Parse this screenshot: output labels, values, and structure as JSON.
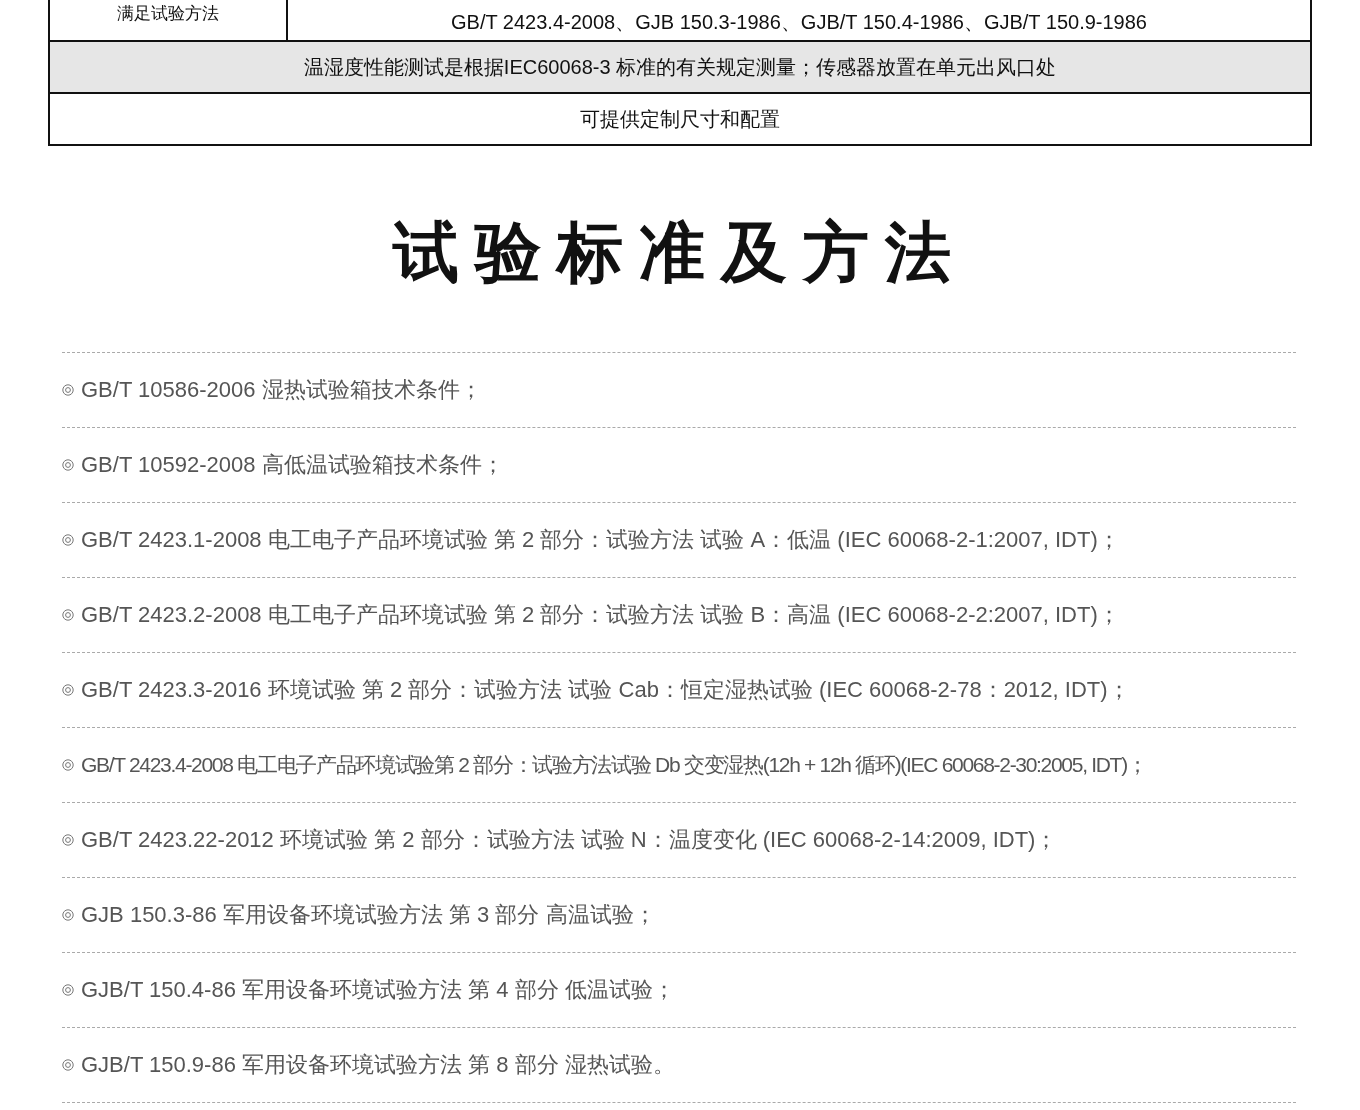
{
  "spec_table": {
    "rows": [
      {
        "kind": "split",
        "label": "满足试验方法",
        "value": "GB/T 2423.4-2008、GJB 150.3-1986、GJB/T 150.4-1986、GJB/T 150.9-1986"
      },
      {
        "kind": "note",
        "shaded": true,
        "value": "温湿度性能测试是根据IEC60068-3 标准的有关规定测量；传感器放置在单元出风口处"
      },
      {
        "kind": "note",
        "shaded": false,
        "value": "可提供定制尺寸和配置"
      }
    ]
  },
  "section_title": "试验标准及方法",
  "standards": [
    {
      "kind": "normal",
      "text": "GB/T 10586-2006 湿热试验箱技术条件；"
    },
    {
      "kind": "normal",
      "text": "GB/T 10592-2008 高低温试验箱技术条件；"
    },
    {
      "kind": "normal",
      "text": "GB/T 2423.1-2008 电工电子产品环境试验 第 2 部分：试验方法 试验 A：低温 (IEC 60068-2-1:2007, IDT)；"
    },
    {
      "kind": "normal",
      "text": "GB/T 2423.2-2008 电工电子产品环境试验 第 2 部分：试验方法 试验 B：高温 (IEC 60068-2-2:2007, IDT)；"
    },
    {
      "kind": "normal",
      "text": "GB/T 2423.3-2016 环境试验 第 2 部分：试验方法 试验 Cab：恒定湿热试验 (IEC 60068-2-78：2012, IDT)；"
    },
    {
      "kind": "condensed",
      "text": "GB/T 2423.4-2008 电工电子产品环境试验第 2 部分：试验方法试验 Db 交变湿热(12h + 12h 循环)(IEC 60068-2-30:2005, IDT)；"
    },
    {
      "kind": "normal",
      "text": "GB/T 2423.22-2012 环境试验 第 2 部分：试验方法 试验 N：温度变化 (IEC 60068-2-14:2009, IDT)；"
    },
    {
      "kind": "normal",
      "text": "GJB 150.3-86 军用设备环境试验方法 第 3 部分 高温试验；"
    },
    {
      "kind": "normal",
      "text": "GJB/T 150.4-86 军用设备环境试验方法 第 4 部分 低温试验；"
    },
    {
      "kind": "normal",
      "text": "GJB/T 150.9-86 军用设备环境试验方法 第 8 部分 湿热试验。"
    }
  ]
}
